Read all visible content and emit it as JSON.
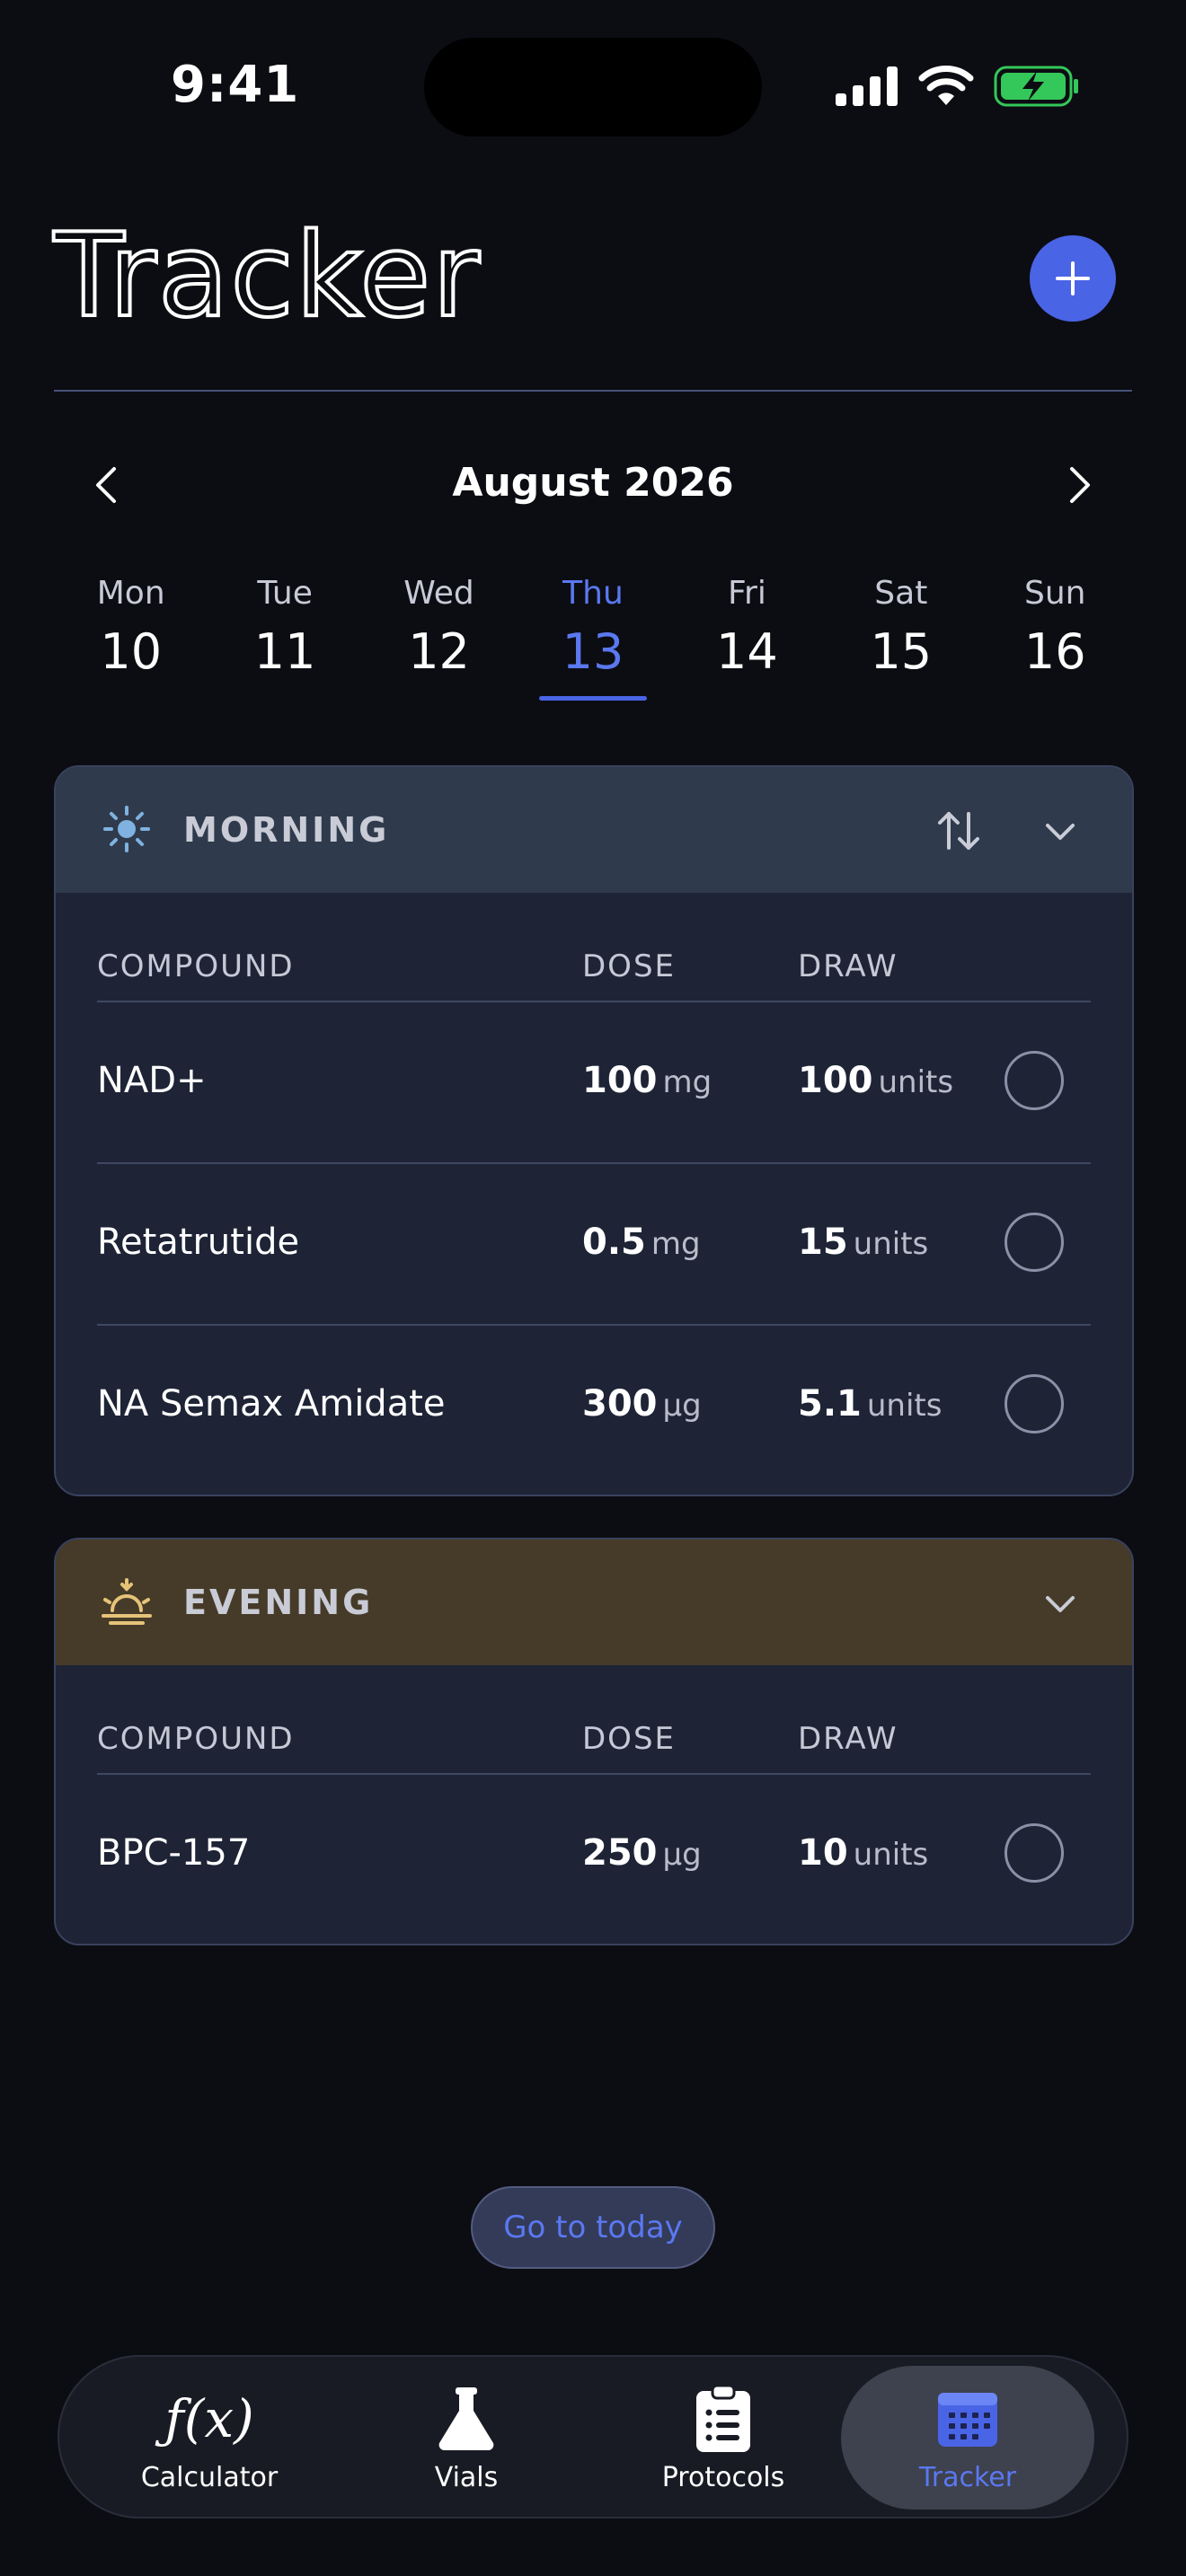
{
  "status_bar": {
    "time": "9:41"
  },
  "header": {
    "title": "Tracker"
  },
  "calendar": {
    "month_label": "August 2026",
    "days": [
      {
        "name": "Mon",
        "num": "10"
      },
      {
        "name": "Tue",
        "num": "11"
      },
      {
        "name": "Wed",
        "num": "12"
      },
      {
        "name": "Thu",
        "num": "13",
        "selected": true
      },
      {
        "name": "Fri",
        "num": "14"
      },
      {
        "name": "Sat",
        "num": "15"
      },
      {
        "name": "Sun",
        "num": "16"
      }
    ]
  },
  "colors": {
    "accent": "#4a64e6",
    "morning_header": "#2f3b4c",
    "evening_header": "#463b28",
    "battery": "#34c759"
  },
  "morning": {
    "label": "MORNING",
    "columns": [
      "COMPOUND",
      "DOSE",
      "DRAW"
    ],
    "rows": [
      {
        "compound": "NAD+",
        "dose": "100",
        "dose_unit": "mg",
        "draw": "100",
        "draw_unit": "units"
      },
      {
        "compound": "Retatrutide",
        "dose": "0.5",
        "dose_unit": "mg",
        "draw": "15",
        "draw_unit": "units"
      },
      {
        "compound": "NA Semax Amidate",
        "dose": "300",
        "dose_unit": "µg",
        "draw": "5.1",
        "draw_unit": "units"
      }
    ]
  },
  "evening": {
    "label": "EVENING",
    "columns": [
      "COMPOUND",
      "DOSE",
      "DRAW"
    ],
    "rows": [
      {
        "compound": "BPC-157",
        "dose": "250",
        "dose_unit": "µg",
        "draw": "10",
        "draw_unit": "units"
      }
    ]
  },
  "today_button": "Go to today",
  "tabs": [
    {
      "label": "Calculator",
      "icon": "function-icon"
    },
    {
      "label": "Vials",
      "icon": "flask-icon"
    },
    {
      "label": "Protocols",
      "icon": "clipboard-icon"
    },
    {
      "label": "Tracker",
      "icon": "calendar-icon",
      "active": true
    }
  ]
}
